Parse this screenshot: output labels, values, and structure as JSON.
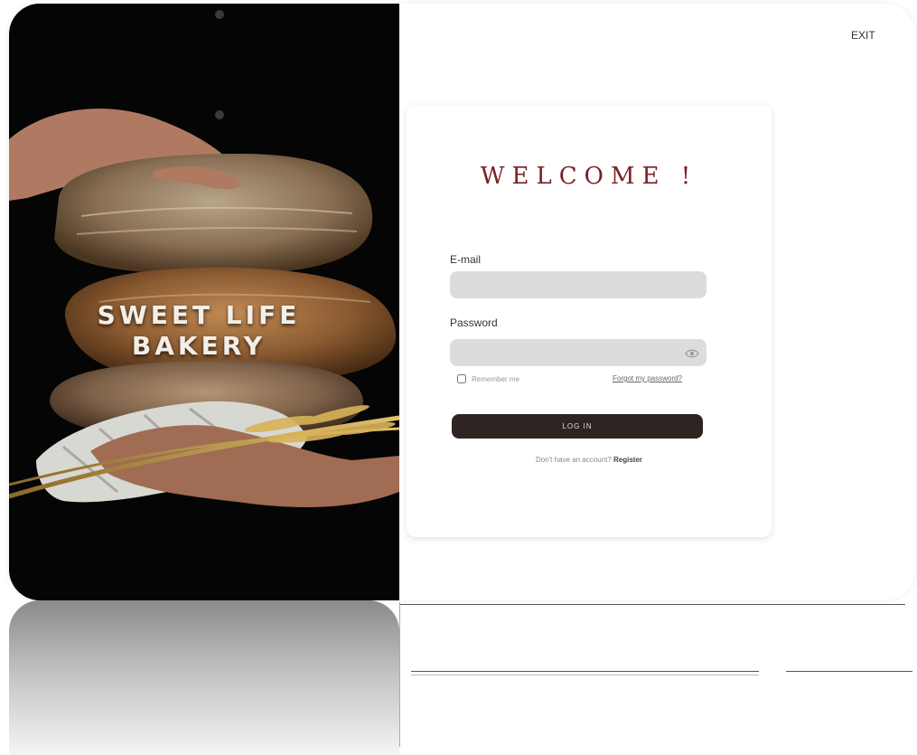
{
  "brand": {
    "line1": "SWEET LIFE",
    "line2": "BAKERY"
  },
  "header": {
    "exit_label": "EXIT"
  },
  "login": {
    "welcome": "WELCOME !",
    "email_label": "E-mail",
    "email_value": "",
    "password_label": "Password",
    "password_value": "",
    "remember_label": "Remember me",
    "forgot_label": "Forgot my password?",
    "login_button": "LOG IN",
    "register_prompt": "Don't have an account?",
    "register_link": "Register"
  },
  "icons": {
    "password_toggle": "eye-icon"
  },
  "colors": {
    "accent": "#7a1f24",
    "button": "#2e2522",
    "input_bg": "#dcdcdc",
    "hero_bg": "#050505"
  }
}
